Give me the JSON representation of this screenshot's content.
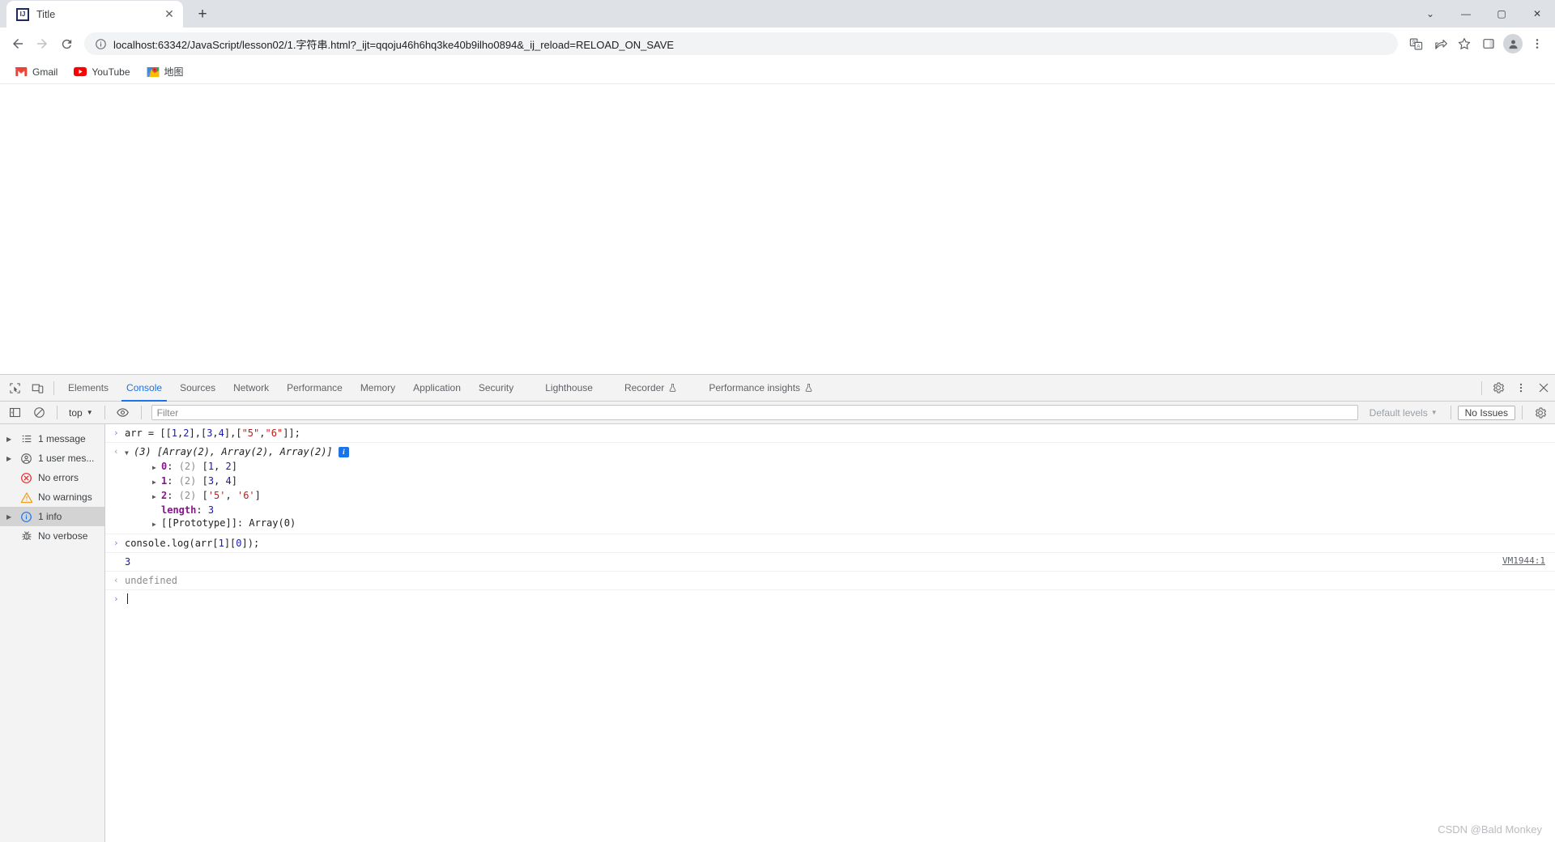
{
  "browser": {
    "tab": {
      "title": "Title",
      "favicon_name": "intellij-idea-favicon",
      "close_label": "✕"
    },
    "new_tab_label": "+",
    "window_controls": {
      "minimize": "—",
      "maximize": "▢",
      "close": "✕",
      "more": "⌄"
    },
    "nav": {
      "back": "←",
      "forward": "→",
      "reload": "⟳"
    },
    "omnibox": {
      "url": "localhost:63342/JavaScript/lesson02/1.字符串.html?_ijt=qqoju46h6hq3ke40b9ilho0894&_ij_reload=RELOAD_ON_SAVE",
      "info_icon": "site-information-icon"
    },
    "toolbar_icons": [
      "translate-icon",
      "share-icon",
      "bookmark-star-icon",
      "side-panel-icon",
      "profile-avatar",
      "chrome-menu-icon"
    ],
    "bookmarks": [
      {
        "label": "Gmail",
        "icon": "gmail-icon"
      },
      {
        "label": "YouTube",
        "icon": "youtube-icon"
      },
      {
        "label": "地图",
        "icon": "google-maps-icon"
      }
    ]
  },
  "devtools": {
    "left_icons": [
      "inspect-element-icon",
      "device-toolbar-icon"
    ],
    "tabs": [
      {
        "label": "Elements",
        "active": false,
        "experimental": false
      },
      {
        "label": "Console",
        "active": true,
        "experimental": false
      },
      {
        "label": "Sources",
        "active": false,
        "experimental": false
      },
      {
        "label": "Network",
        "active": false,
        "experimental": false
      },
      {
        "label": "Performance",
        "active": false,
        "experimental": false
      },
      {
        "label": "Memory",
        "active": false,
        "experimental": false
      },
      {
        "label": "Application",
        "active": false,
        "experimental": false
      },
      {
        "label": "Security",
        "active": false,
        "experimental": false
      },
      {
        "label": "Lighthouse",
        "active": false,
        "experimental": false
      },
      {
        "label": "Recorder",
        "active": false,
        "experimental": true
      },
      {
        "label": "Performance insights",
        "active": false,
        "experimental": true
      }
    ],
    "right_icons": [
      "settings-gear-icon",
      "more-options-icon",
      "close-devtools-icon"
    ],
    "filterbar": {
      "sidebar_toggle": "console-sidebar-toggle-icon",
      "clear_console": "clear-console-icon",
      "context": "top",
      "eye_icon": "live-expression-icon",
      "filter_placeholder": "Filter",
      "filter_value": "",
      "levels": "Default levels",
      "issues": "No Issues",
      "settings": "console-settings-icon"
    },
    "sidebar": [
      {
        "label": "1 message",
        "icon": "list-icon",
        "expandable": true,
        "selected": false
      },
      {
        "label": "1 user mes...",
        "icon": "user-message-icon",
        "expandable": true,
        "selected": false
      },
      {
        "label": "No errors",
        "icon": "error-icon",
        "expandable": false,
        "selected": false
      },
      {
        "label": "No warnings",
        "icon": "warning-icon",
        "expandable": false,
        "selected": false
      },
      {
        "label": "1 info",
        "icon": "info-icon",
        "expandable": true,
        "selected": true
      },
      {
        "label": "No verbose",
        "icon": "verbose-bug-icon",
        "expandable": false,
        "selected": false
      }
    ],
    "console": {
      "input_1": {
        "gutter": "›",
        "parts": [
          {
            "t": "arr = [[",
            "c": "plain"
          },
          {
            "t": "1",
            "c": "num"
          },
          {
            "t": ",",
            "c": "plain"
          },
          {
            "t": "2",
            "c": "num"
          },
          {
            "t": "],[",
            "c": "plain"
          },
          {
            "t": "3",
            "c": "num"
          },
          {
            "t": ",",
            "c": "plain"
          },
          {
            "t": "4",
            "c": "num"
          },
          {
            "t": "],[",
            "c": "plain"
          },
          {
            "t": "\"5\"",
            "c": "str"
          },
          {
            "t": ",",
            "c": "plain"
          },
          {
            "t": "\"6\"",
            "c": "str"
          },
          {
            "t": "]];",
            "c": "plain"
          }
        ]
      },
      "result_1": {
        "gutter": "‹",
        "disclosure": "▼",
        "summary": "(3) [Array(2), Array(2), Array(2)]",
        "badge": "i",
        "rows": [
          {
            "disclosure": "▶",
            "key": "0",
            "value": "(2) [1, 2]",
            "vparts": [
              {
                "t": "(2) ",
                "c": "grey"
              },
              {
                "t": "[",
                "c": "plain"
              },
              {
                "t": "1",
                "c": "num"
              },
              {
                "t": ", ",
                "c": "plain"
              },
              {
                "t": "2",
                "c": "num"
              },
              {
                "t": "]",
                "c": "plain"
              }
            ]
          },
          {
            "disclosure": "▶",
            "key": "1",
            "value": "(2) [3, 4]",
            "vparts": [
              {
                "t": "(2) ",
                "c": "grey"
              },
              {
                "t": "[",
                "c": "plain"
              },
              {
                "t": "3",
                "c": "num"
              },
              {
                "t": ", ",
                "c": "plain"
              },
              {
                "t": "4",
                "c": "num"
              },
              {
                "t": "]",
                "c": "plain"
              }
            ]
          },
          {
            "disclosure": "▶",
            "key": "2",
            "value": "(2) ['5', '6']",
            "vparts": [
              {
                "t": "(2) ",
                "c": "grey"
              },
              {
                "t": "[",
                "c": "plain"
              },
              {
                "t": "'5'",
                "c": "str"
              },
              {
                "t": ", ",
                "c": "plain"
              },
              {
                "t": "'6'",
                "c": "str"
              },
              {
                "t": "]",
                "c": "plain"
              }
            ]
          },
          {
            "disclosure": "",
            "key": "length",
            "value": "3",
            "vparts": [
              {
                "t": "3",
                "c": "num"
              }
            ]
          },
          {
            "disclosure": "▶",
            "key": "[[Prototype]]",
            "value": "Array(0)",
            "plainkey": true,
            "vparts": [
              {
                "t": "Array(0)",
                "c": "plain"
              }
            ]
          }
        ]
      },
      "input_2": {
        "gutter": "›",
        "parts": [
          {
            "t": "console.log(arr[",
            "c": "plain"
          },
          {
            "t": "1",
            "c": "num"
          },
          {
            "t": "][",
            "c": "plain"
          },
          {
            "t": "0",
            "c": "num"
          },
          {
            "t": "]);",
            "c": "plain"
          }
        ]
      },
      "log_output": {
        "text": "3",
        "source": "VM1944:1"
      },
      "result_2": {
        "gutter": "‹",
        "text": "undefined"
      },
      "prompt": {
        "gutter": "›",
        "value": ""
      }
    }
  },
  "watermark": "CSDN @Bald Monkey"
}
